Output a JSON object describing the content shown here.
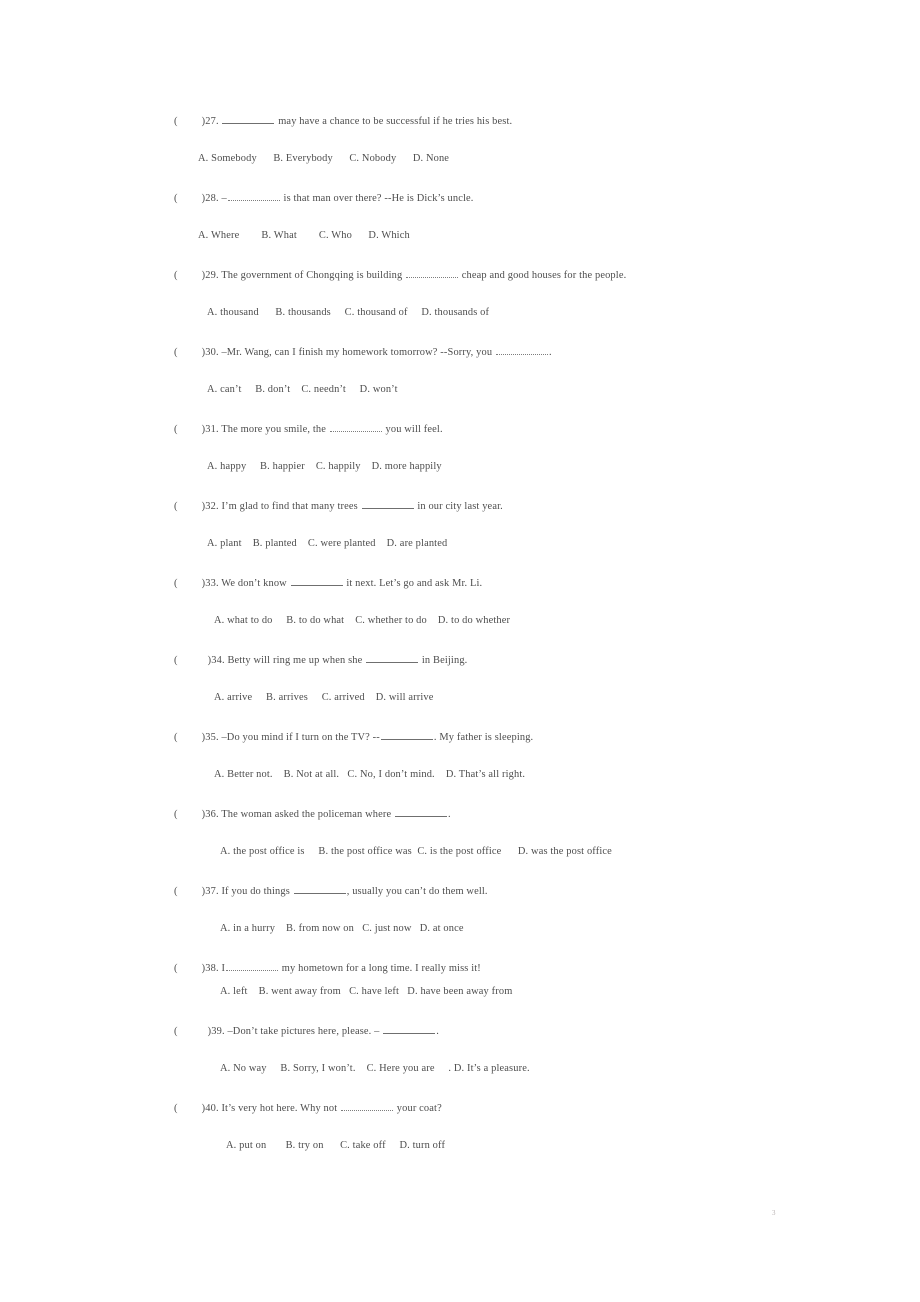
{
  "document": {
    "page_number": "3",
    "text_color": "#4d4d4d",
    "background_color": "#ffffff",
    "blank_rule_color": "#6f6f6f"
  },
  "questions": [
    {
      "marker_open": "(",
      "marker_close": ")",
      "number": "27.",
      "stem_before": " ",
      "stem_after": " may have a chance to be successful if he tries his best.",
      "blank_style": "solid",
      "options_indent": 24,
      "options_gap": 38,
      "options": [
        "A. Somebody",
        "B. Everybody",
        "C. Nobody",
        "D. None"
      ],
      "option_spaces": [
        6,
        6,
        6
      ]
    },
    {
      "marker_open": "(",
      "marker_close": ")",
      "number": "28.",
      "stem_before": " –",
      "stem_after": " is that man over there? --He is Dick’s uncle.",
      "blank_style": "dotted",
      "options_indent": 24,
      "options_gap": 38,
      "options": [
        "A. Where",
        "B. What",
        "C. Who",
        "D. Which"
      ],
      "option_spaces": [
        8,
        8,
        6
      ]
    },
    {
      "marker_open": "(",
      "marker_close": ")",
      "number": "29.",
      "stem_before": " The government of Chongqing is building ",
      "stem_after": " cheap and good houses for the people.",
      "blank_style": "dotted",
      "options_indent": 33,
      "options_gap": 38,
      "options": [
        "A. thousand",
        "B. thousands",
        "C. thousand of",
        "D. thousands of"
      ],
      "option_spaces": [
        6,
        5,
        5
      ]
    },
    {
      "marker_open": "(",
      "marker_close": ")",
      "number": "30.",
      "stem_before": " –Mr. Wang, can I finish my homework tomorrow? --Sorry, you ",
      "stem_after": ".",
      "blank_style": "dotted",
      "options_indent": 33,
      "options_gap": 38,
      "options": [
        "A. can’t",
        "B. don’t",
        "C. needn’t",
        "D. won’t"
      ],
      "option_spaces": [
        5,
        4,
        5
      ]
    },
    {
      "marker_open": "(",
      "marker_close": ")",
      "number": "31.",
      "stem_before": " The more you smile, the ",
      "stem_after": " you will feel.",
      "blank_style": "dotted",
      "options_indent": 33,
      "options_gap": 38,
      "options": [
        "A. happy",
        "B. happier",
        "C. happily",
        "D. more happily"
      ],
      "option_spaces": [
        5,
        4,
        4
      ]
    },
    {
      "marker_open": "(",
      "marker_close": ")",
      "number": "32.",
      "stem_before": " I’m glad to find that many trees ",
      "stem_after": " in our city last year.",
      "blank_style": "solid",
      "options_indent": 33,
      "options_gap": 38,
      "options": [
        "A. plant",
        "B. planted",
        "C. were planted",
        "D. are planted"
      ],
      "option_spaces": [
        4,
        4,
        4
      ]
    },
    {
      "marker_open": "(",
      "marker_close": ")",
      "number": "33.",
      "stem_before": " We don’t know ",
      "stem_after": " it next. Let’s go and ask Mr. Li.",
      "blank_style": "solid",
      "options_indent": 40,
      "options_gap": 38,
      "options": [
        "A. what to do",
        "B. to do what",
        "C. whether to do",
        "D. to do whether"
      ],
      "option_spaces": [
        5,
        4,
        4
      ]
    },
    {
      "marker_open": "(",
      "marker_close": ")",
      "number": "34.",
      "stem_before": " Betty will ring me up when she ",
      "stem_after": " in Beijing.",
      "blank_style": "solid",
      "options_indent": 40,
      "options_gap": 38,
      "options": [
        "A. arrive",
        "B. arrives",
        "C. arrived",
        "D. will arrive"
      ],
      "option_spaces": [
        5,
        5,
        4
      ],
      "marker_gap_wide": true
    },
    {
      "marker_open": "(",
      "marker_close": ")",
      "number": "35.",
      "stem_before": " –Do you mind if I turn on the TV? --",
      "stem_after": ". My father is sleeping.",
      "blank_style": "solid",
      "options_indent": 40,
      "options_gap": 38,
      "options": [
        "A. Better not.",
        "B. Not at all.",
        "C. No, I don’t mind.",
        "D. That’s all right."
      ],
      "option_spaces": [
        4,
        3,
        4
      ]
    },
    {
      "marker_open": "(",
      "marker_close": ")",
      "number": "36.",
      "stem_before": " The woman asked the policeman where ",
      "stem_after": ".",
      "blank_style": "solid",
      "options_indent": 46,
      "options_gap": 38,
      "options": [
        "A. the post office is",
        "B. the post office was",
        "C. is the post office",
        "D. was the post office"
      ],
      "option_spaces": [
        5,
        2,
        6
      ]
    },
    {
      "marker_open": "(",
      "marker_close": ")",
      "number": "37.",
      "stem_before": " If you do things ",
      "stem_after": ", usually you can’t do them well.",
      "blank_style": "solid",
      "options_indent": 46,
      "options_gap": 38,
      "options": [
        "A. in a hurry",
        "B. from now on",
        "C. just now",
        "D. at once"
      ],
      "option_spaces": [
        4,
        3,
        3
      ]
    },
    {
      "marker_open": "(",
      "marker_close": ")",
      "number": "38.",
      "stem_before": " I",
      "stem_after": " my hometown for a long time. I really miss it!",
      "blank_style": "dotted",
      "options_indent": 46,
      "options_gap": 24,
      "options": [
        "A. left",
        "B. went away from",
        "C. have left",
        "D. have been away from"
      ],
      "option_spaces": [
        4,
        3,
        3
      ]
    },
    {
      "marker_open": "(",
      "marker_close": ")",
      "number": "39.",
      "stem_before": " –Don’t take pictures here, please. – ",
      "stem_after": ".",
      "blank_style": "solid",
      "options_indent": 46,
      "options_gap": 38,
      "options": [
        "A. No way",
        "B. Sorry, I won’t.",
        "C. Here you are",
        ". D. It’s a pleasure."
      ],
      "option_spaces": [
        5,
        4,
        5
      ],
      "marker_gap_wide": true
    },
    {
      "marker_open": "(",
      "marker_close": ")",
      "number": "40.",
      "stem_before": " It’s very hot here. Why not ",
      "stem_after": " your coat?",
      "blank_style": "dotted",
      "options_indent": 52,
      "options_gap": 38,
      "options": [
        "A. put on",
        "B. try on",
        "C. take off",
        "D. turn off"
      ],
      "option_spaces": [
        7,
        6,
        5
      ]
    }
  ]
}
